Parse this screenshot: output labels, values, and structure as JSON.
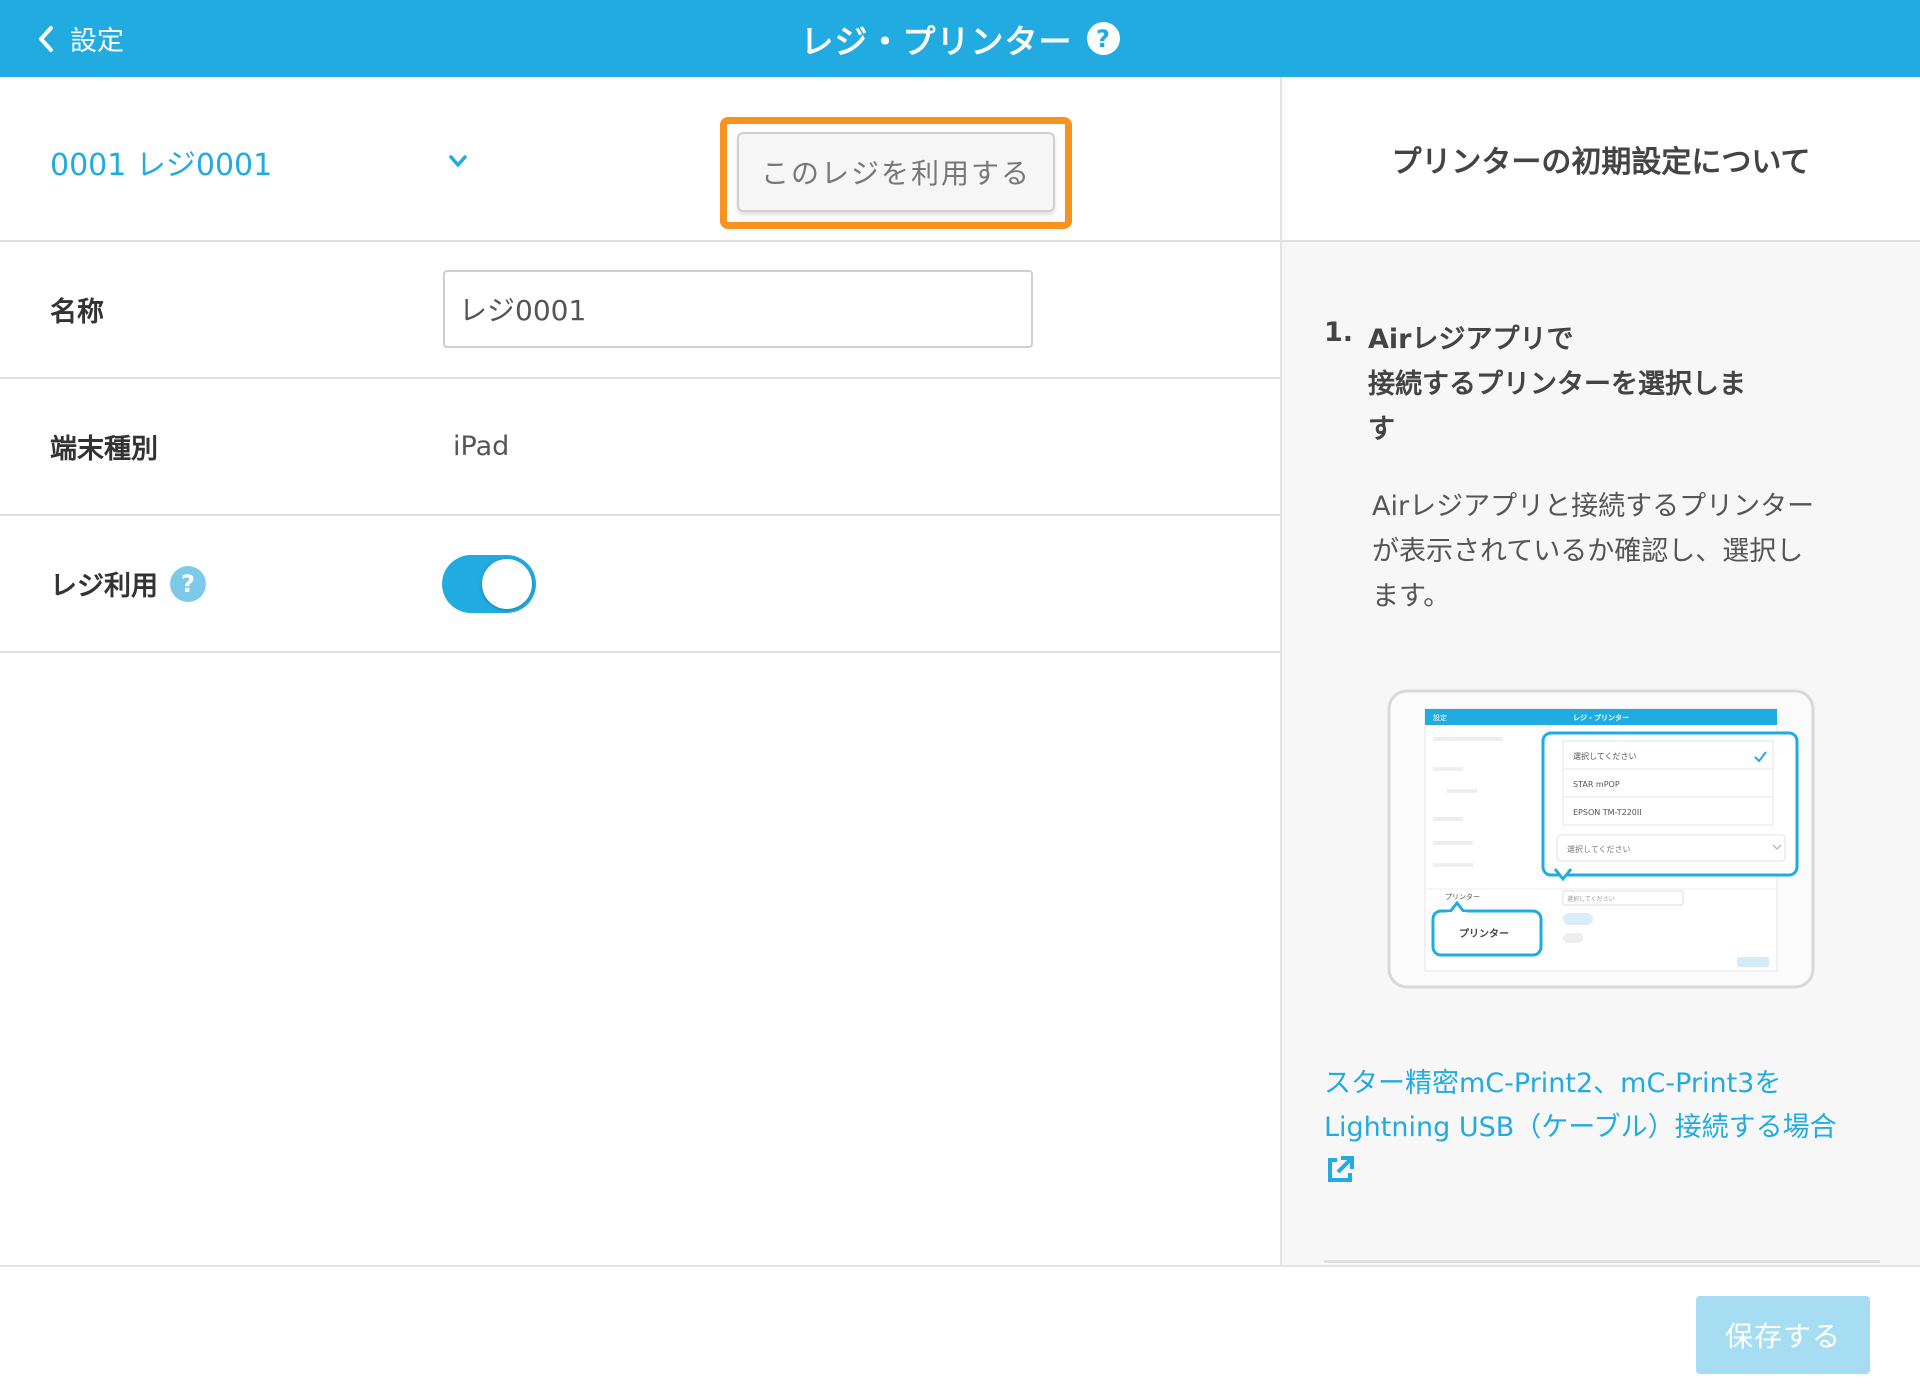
{
  "header": {
    "back_label": "設定",
    "title": "レジ・プリンター",
    "help_glyph": "?"
  },
  "register": {
    "selected": "0001 レジ0001",
    "use_button": "このレジを利用する"
  },
  "fields": {
    "name_label": "名称",
    "name_value": "レジ0001",
    "device_label": "端末種別",
    "device_value": "iPad",
    "usage_label": "レジ利用",
    "usage_help_glyph": "?",
    "usage_enabled": true
  },
  "help_panel": {
    "title": "プリンターの初期設定について",
    "step_number": "1.",
    "step_title_lines": [
      "Airレジアプリで",
      "接続するプリンターを選択しま",
      "す"
    ],
    "step_description_lines": [
      "Airレジアプリと接続するプリンター",
      "が表示されているか確認し、選択し",
      "ます。"
    ],
    "link_lines": [
      "スター精密mC-Print2、mC-Print3を",
      "Lightning USB（ケーブル）接続する場合"
    ],
    "illustration": {
      "title": "レジ・プリンター",
      "back_label": "設定",
      "options": [
        "選択してください",
        "STAR mPOP",
        "EPSON TM-T220II"
      ],
      "select_placeholder": "選択してください",
      "small_select_placeholder": "選択してください",
      "row_label": "プリンター",
      "callout_label": "プリンター"
    }
  },
  "footer": {
    "save_button": "保存する"
  },
  "colors": {
    "brand": "#21ABE1",
    "highlight": "#F7931E",
    "save_disabled": "#A6DDF3"
  }
}
